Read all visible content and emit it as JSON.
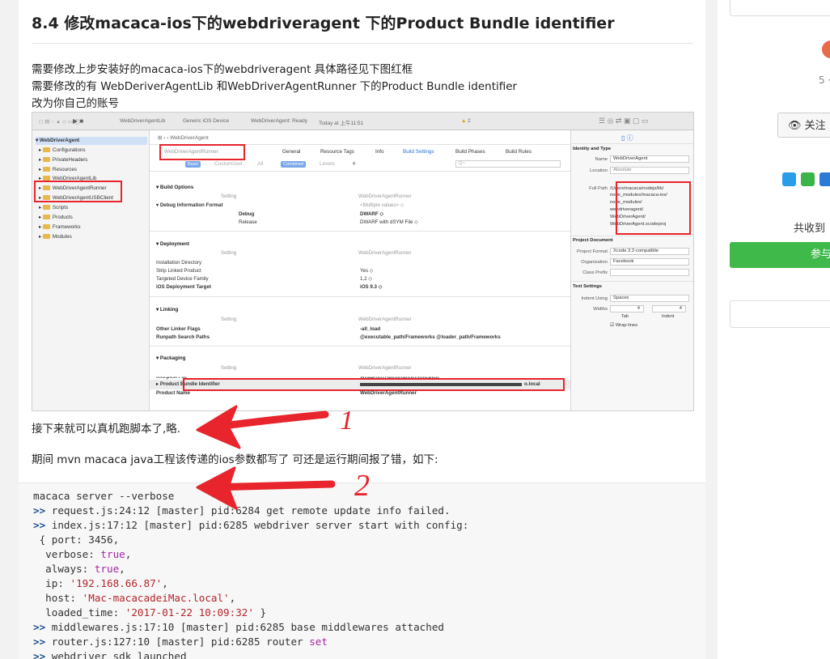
{
  "article": {
    "title": "8.4 修改macaca-ios下的webdriveragent 下的Product Bundle identifier",
    "intro_lines": [
      "需要修改上步安装好的macaca-ios下的webdriveragent 具体路径见下图红框",
      "需要修改的有 WebDeriverAgentLib 和WebDriverAgentRunner 下的Product Bundle identifier",
      "改为你自己的账号"
    ],
    "after_image_text": "接下来就可以真机跑脚本了,略.",
    "error_intro": "期间 mvn macaca java工程该传递的ios参数都写了 可还是运行期间报了错，如下:",
    "annotation_1": "1",
    "annotation_2": "2",
    "annotation_color": "#e8242c"
  },
  "xcode": {
    "breadcrumb_target": "WebDriverAgentLib",
    "breadcrumb_device": "Generic iOS Device",
    "status": "WebDriverAgent: Ready",
    "status_time": "Today at 上午11:51",
    "warnings": "2",
    "jump_bar": "WebDriverAgent",
    "navigator": [
      "WebDriverAgent",
      "Configurations",
      "PrivateHeaders",
      "Resources",
      "WebDriverAgentLib",
      "WebDriverAgentRunner",
      "WebDriverAgentUSBClient",
      "Scripts",
      "Products",
      "Frameworks",
      "Modules"
    ],
    "target_selector": "WebDriverAgentRunner",
    "tabs": [
      "General",
      "Resource Tags",
      "Info",
      "Build Settings",
      "Build Phases",
      "Build Rules"
    ],
    "filter_tabs": [
      "Basic",
      "Customized",
      "All",
      "Combined",
      "Levels"
    ],
    "search_placeholder": "Q~",
    "col_setting": "Setting",
    "col_target": "WebDriverAgentRunner",
    "sections": {
      "build_options": "Build Options",
      "debug_info": "Debug Information Format",
      "debug_info_value": "<Multiple values> ◇",
      "debug": "Debug",
      "debug_value": "DWARF ◇",
      "release": "Release",
      "release_value": "DWARF with dSYM File ◇",
      "deployment": "Deployment",
      "install_dir": "Installation Directory",
      "strip": "Strip Linked Product",
      "strip_value": "Yes ◇",
      "family": "Targeted Device Family",
      "family_value": "1,2 ◇",
      "ios_target": "iOS Deployment Target",
      "ios_target_value": "iOS 9.3 ◇",
      "linking": "Linking",
      "other_linker": "Other Linker Flags",
      "other_linker_value": "-all_load",
      "runpath": "Runpath Search Paths",
      "runpath_value": "@executable_path/Frameworks @loader_path/Frameworks",
      "packaging": "Packaging",
      "info_plist": "Info.plist File",
      "info_plist_value": "WebDriverAgentRunner/Info.plist",
      "bundle_id": "Product Bundle Identifier",
      "bundle_id_value": "o.local",
      "product_name": "Product Name",
      "product_name_value": "WebDriverAgentRunner"
    },
    "inspector": {
      "identity_head": "Identity and Type",
      "name_label": "Name",
      "name_value": "WebDriverAgent",
      "location_label": "Location",
      "location_value": "Absolute",
      "full_path_label": "Full Path",
      "full_path_lines": [
        "/Users/macaca/nodejs/lib/",
        "node_modules/macaca-ios/",
        "node_modules/",
        "webdriveragent/",
        "WebDriverAgent/",
        "WebDriverAgent.xcodeproj"
      ],
      "project_doc_head": "Project Document",
      "project_format_label": "Project Format",
      "project_format_value": "Xcode 3.2-compatible",
      "org_label": "Organization",
      "org_value": "Facebook",
      "class_prefix_label": "Class Prefix",
      "text_settings_head": "Text Settings",
      "indent_label": "Indent Using",
      "indent_value": "Spaces",
      "widths_label": "Widths",
      "tab_width": "4",
      "indent_width": "4",
      "tab_label": "Tab",
      "indent_small_label": "Indent",
      "wrap_label": "Wrap lines"
    }
  },
  "code_lines": [
    [
      {
        "t": "macaca server --verbose",
        "c": ""
      }
    ],
    [
      {
        "t": ">> ",
        "c": "prompt"
      },
      {
        "t": "request.js:24:12 [master] pid:6284 get remote update info failed.",
        "c": ""
      }
    ],
    [
      {
        "t": ">> ",
        "c": "prompt"
      },
      {
        "t": "index.js:17:12 [master] pid:6285 webdriver server start with config:",
        "c": ""
      }
    ],
    [
      {
        "t": " { port: 3456,",
        "c": ""
      }
    ],
    [
      {
        "t": "  verbose: ",
        "c": ""
      },
      {
        "t": "true",
        "c": "kw"
      },
      {
        "t": ",",
        "c": ""
      }
    ],
    [
      {
        "t": "  always: ",
        "c": ""
      },
      {
        "t": "true",
        "c": "kw"
      },
      {
        "t": ",",
        "c": ""
      }
    ],
    [
      {
        "t": "  ip: ",
        "c": ""
      },
      {
        "t": "'192.168.66.87'",
        "c": "str"
      },
      {
        "t": ",",
        "c": ""
      }
    ],
    [
      {
        "t": "  host: ",
        "c": ""
      },
      {
        "t": "'Mac-macacadeiMac.local'",
        "c": "str"
      },
      {
        "t": ",",
        "c": ""
      }
    ],
    [
      {
        "t": "  loaded_time: ",
        "c": ""
      },
      {
        "t": "'2017-01-22 10:09:32'",
        "c": "str"
      },
      {
        "t": " }",
        "c": ""
      }
    ],
    [
      {
        "t": ">> ",
        "c": "prompt"
      },
      {
        "t": "middlewares.js:17:10 [master] pid:6285 base middlewares attached",
        "c": ""
      }
    ],
    [
      {
        "t": ">> ",
        "c": "prompt"
      },
      {
        "t": "router.js:127:10 [master] pid:6285 router ",
        "c": ""
      },
      {
        "t": "set",
        "c": "kw"
      }
    ],
    [
      {
        "t": ">> ",
        "c": "prompt"
      },
      {
        "t": "webdriver sdk launched",
        "c": ""
      }
    ]
  ],
  "sidebar": {
    "like_count": "5 ·",
    "follow_icon": "eye-icon",
    "follow_label": "关注",
    "collect_label": "共收到",
    "join_label": "参与",
    "share_colors": [
      "#2a9de8",
      "#3bb54a",
      "#2a9de8"
    ]
  }
}
